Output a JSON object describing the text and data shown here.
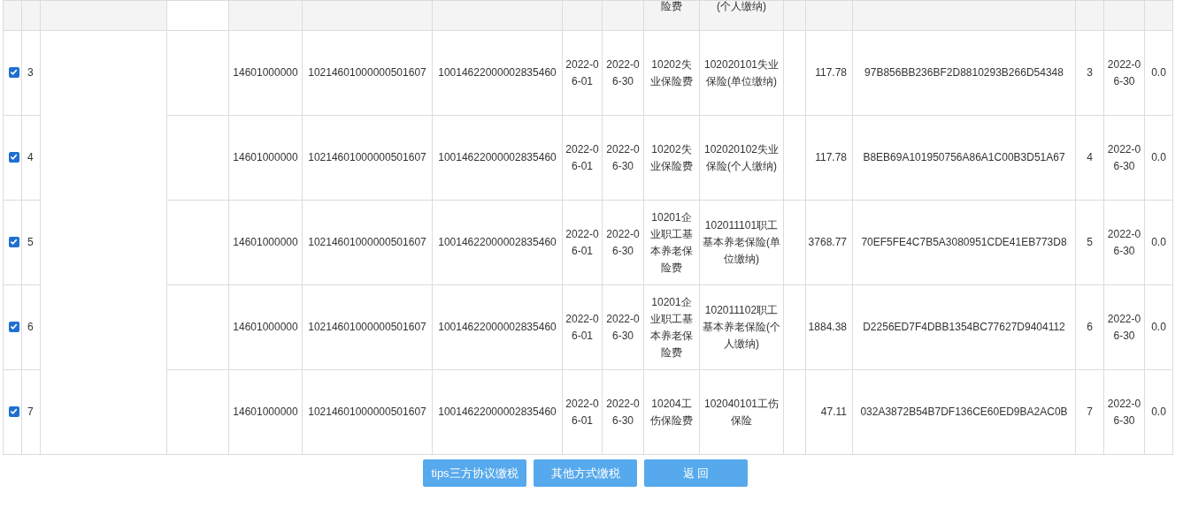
{
  "partial_row": {
    "item": "险费",
    "subitem": "(个人缴纳)"
  },
  "rows": [
    {
      "checked": true,
      "index": "3",
      "code1": "14601000000",
      "code2": "10214601000000501607",
      "code3": "10014622000002835460",
      "start": "2022-06-01",
      "end": "2022-06-30",
      "item": "10202失业保险费",
      "subitem": "102020101失业保险(单位缴纳)",
      "amount": "117.78",
      "hash": "97B856BB236BF2D8810293B266D54348",
      "seq": "3",
      "date": "2022-06-30",
      "value": "0.0"
    },
    {
      "checked": true,
      "index": "4",
      "code1": "14601000000",
      "code2": "10214601000000501607",
      "code3": "10014622000002835460",
      "start": "2022-06-01",
      "end": "2022-06-30",
      "item": "10202失业保险费",
      "subitem": "102020102失业保险(个人缴纳)",
      "amount": "117.78",
      "hash": "B8EB69A101950756A86A1C00B3D51A67",
      "seq": "4",
      "date": "2022-06-30",
      "value": "0.0"
    },
    {
      "checked": true,
      "index": "5",
      "code1": "14601000000",
      "code2": "10214601000000501607",
      "code3": "10014622000002835460",
      "start": "2022-06-01",
      "end": "2022-06-30",
      "item": "10201企业职工基本养老保险费",
      "subitem": "102011101职工基本养老保险(单位缴纳)",
      "amount": "3768.77",
      "hash": "70EF5FE4C7B5A3080951CDE41EB773D8",
      "seq": "5",
      "date": "2022-06-30",
      "value": "0.0"
    },
    {
      "checked": true,
      "index": "6",
      "code1": "14601000000",
      "code2": "10214601000000501607",
      "code3": "10014622000002835460",
      "start": "2022-06-01",
      "end": "2022-06-30",
      "item": "10201企业职工基本养老保险费",
      "subitem": "102011102职工基本养老保险(个人缴纳)",
      "amount": "1884.38",
      "hash": "D2256ED7F4DBB1354BC77627D9404112",
      "seq": "6",
      "date": "2022-06-30",
      "value": "0.0"
    },
    {
      "checked": true,
      "index": "7",
      "code1": "14601000000",
      "code2": "10214601000000501607",
      "code3": "10014622000002835460",
      "start": "2022-06-01",
      "end": "2022-06-30",
      "item": "10204工伤保险费",
      "subitem": "102040101工伤保险",
      "amount": "47.11",
      "hash": "032A3872B54B7DF136CE60ED9BA2AC0B",
      "seq": "7",
      "date": "2022-06-30",
      "value": "0.0"
    }
  ],
  "buttons": [
    "tips三方协议缴税",
    "其他方式缴税",
    "返 回"
  ]
}
